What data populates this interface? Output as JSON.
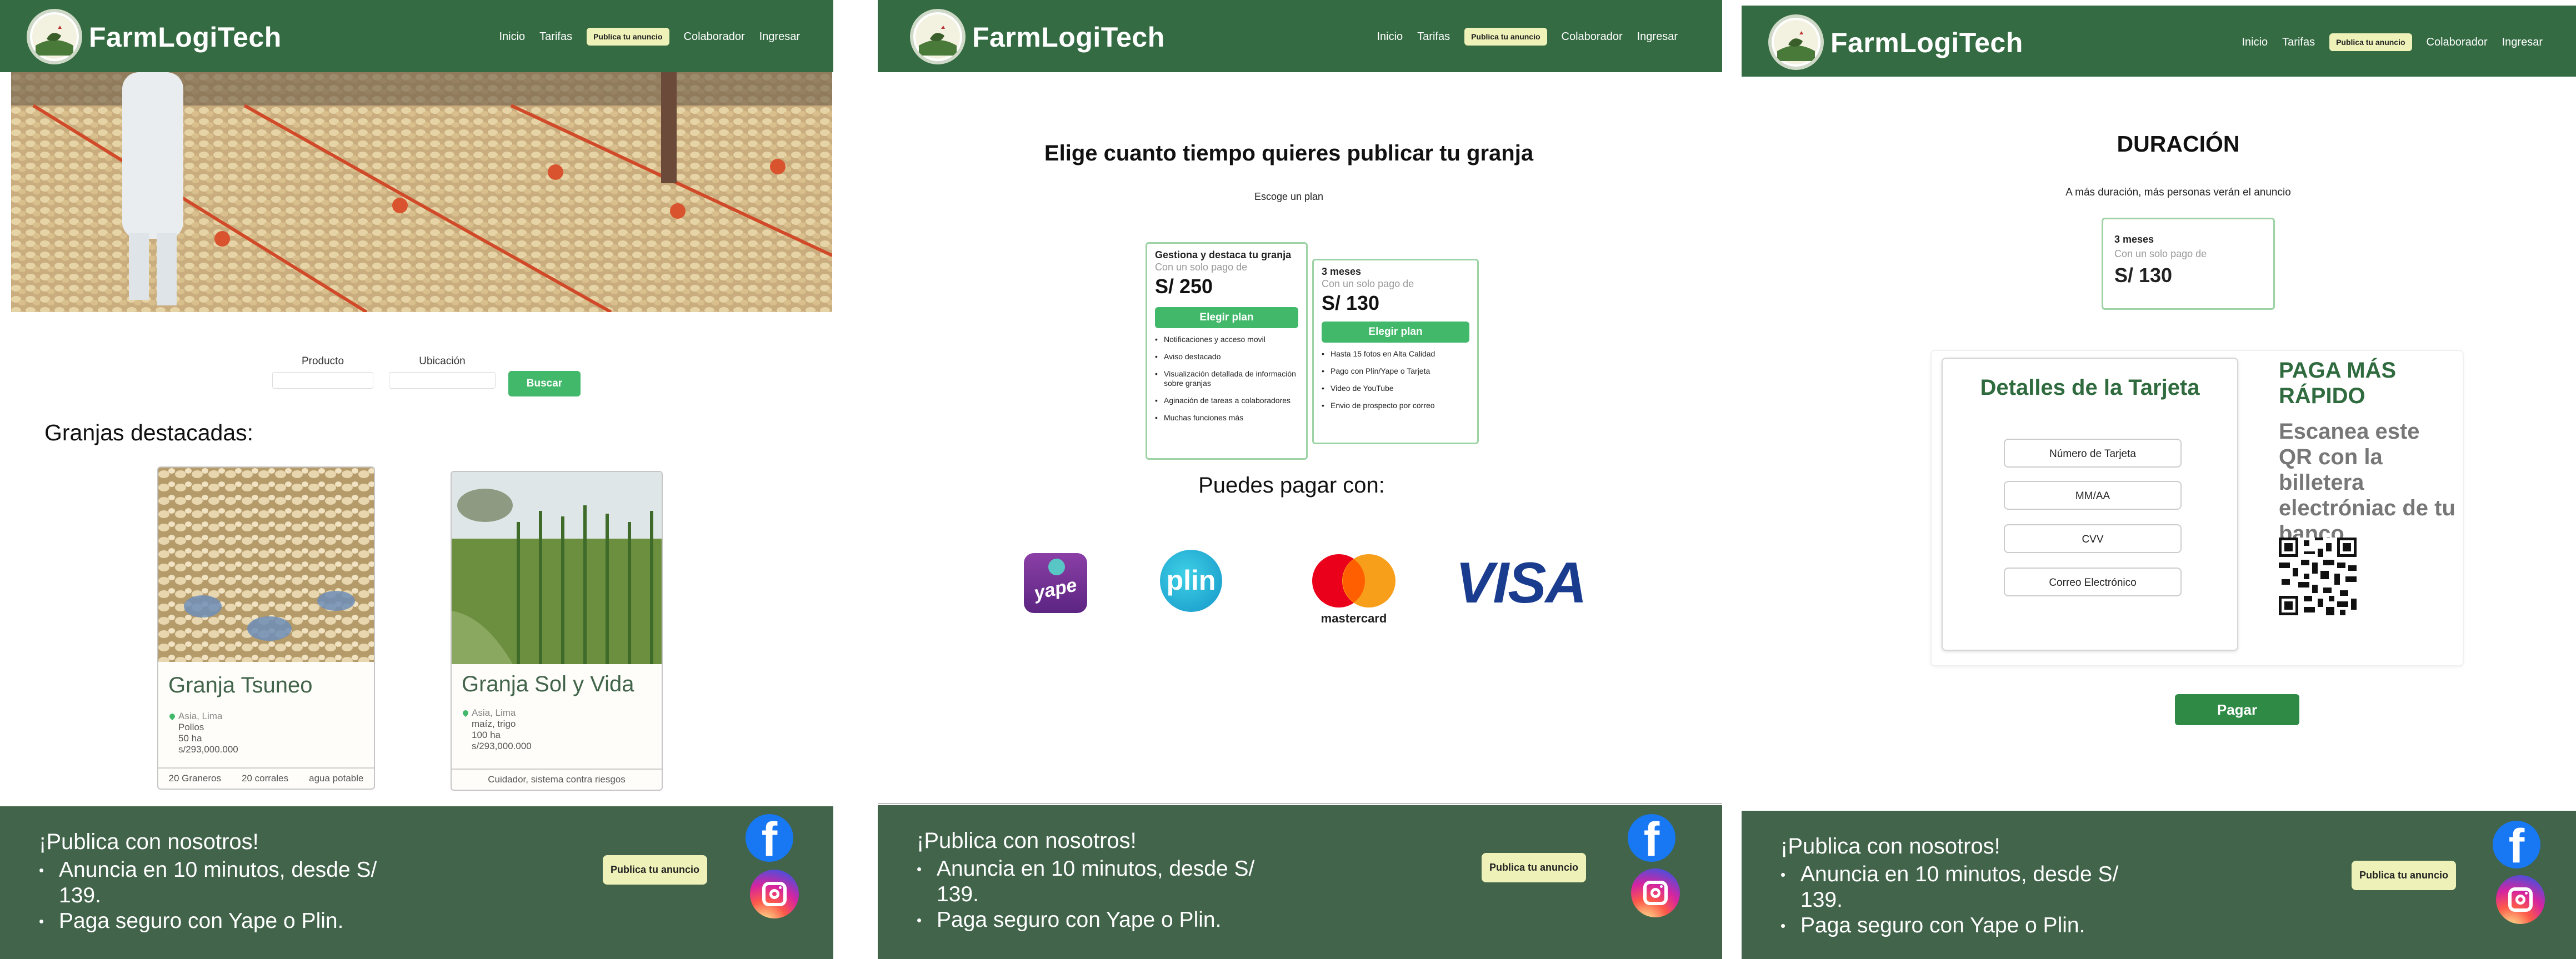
{
  "brand": {
    "name": "FarmLogiTech"
  },
  "nav": {
    "inicio": "Inicio",
    "tarifas": "Tarifas",
    "publica": "Publica tu anuncio",
    "colaborador": "Colaborador",
    "ingresar": "Ingresar"
  },
  "footer": {
    "title": "¡Publica con nosotros!",
    "items": [
      "Anuncia en 10 minutos, desde S/ 139.",
      "Paga seguro con Yape o Plin."
    ],
    "publish_button": "Publica tu anuncio"
  },
  "home": {
    "search": {
      "producto_label": "Producto",
      "ubicacion_label": "Ubicación",
      "button": "Buscar"
    },
    "featured_title": "Granjas destacadas:",
    "farms": [
      {
        "name": "Granja Tsuneo",
        "location": "Asia, Lima",
        "lines": [
          "Pollos",
          "50 ha",
          "s/293,000.000"
        ],
        "tags": [
          "20 Graneros",
          "20 corrales",
          "agua potable"
        ]
      },
      {
        "name": "Granja Sol y Vida",
        "location": "Asia, Lima",
        "lines": [
          "maíz, trigo",
          "100 ha",
          "s/293,000.000"
        ],
        "tags": [
          "Cuidador, sistema contra riesgos"
        ]
      }
    ]
  },
  "plans_page": {
    "title": "Elige cuanto tiempo quieres publicar tu granja",
    "subtitle": "Escoge un plan",
    "plans": [
      {
        "title": "Gestiona y destaca tu granja",
        "note": "Con un solo pago de",
        "price": "S/ 250",
        "button": "Elegir plan",
        "features": [
          "Notificaciones y acceso movil",
          "Aviso destacado",
          "Visualización detallada de información sobre granjas",
          "Aginación de tareas a colaboradores",
          "Muchas funciones más"
        ]
      },
      {
        "title": "3 meses",
        "note": "Con un solo pago de",
        "price": "S/ 130",
        "button": "Elegir plan",
        "features": [
          "Hasta 15 fotos en Alta Calidad",
          "Pago con Plin/Yape o Tarjeta",
          "Video de YouTube",
          "Envio de prospecto por correo"
        ]
      }
    ],
    "pay_title": "Puedes pagar con:",
    "methods": {
      "yape": "yape",
      "plin": "plin",
      "mastercard": "mastercard",
      "visa": "VISA"
    }
  },
  "checkout": {
    "title": "DURACIÓN",
    "subtitle": "A más duración, más personas verán el anuncio",
    "plan": {
      "title": "3 meses",
      "note": "Con un solo pago de",
      "price": "S/ 130"
    },
    "card_title": "Detalles de la Tarjeta",
    "fields": {
      "number": "Número de Tarjeta",
      "expiry": "MM/AA",
      "cvv": "CVV",
      "email": "Correo Electrónico"
    },
    "qr_title": "PAGA MÁS RÁPIDO",
    "qr_text": "Escanea este QR con la billetera electróniac de tu banco",
    "pay_button": "Pagar"
  },
  "colors": {
    "nav": "#346b43",
    "footer": "#41644a",
    "accent": "#42b86a",
    "pay": "#2f8a45",
    "highlight": "#eef2b8"
  }
}
